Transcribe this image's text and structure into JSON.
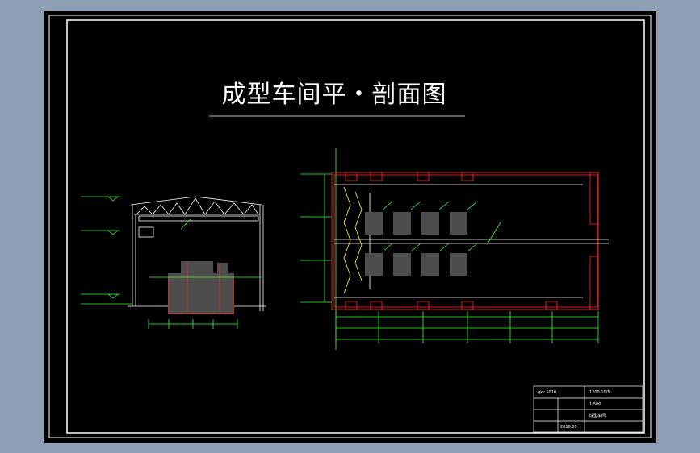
{
  "drawing": {
    "title": "成型车间平・剖面图",
    "colors": {
      "viewport_bg": "#000000",
      "frame": "#ffffff",
      "structure_red": "#ff2a2a",
      "dimension_green": "#33ff33",
      "machine_gray": "#4d4d4d",
      "hatch_yellow": "#ffff33",
      "outer_bg": "#8f9fb5"
    }
  },
  "title_block": {
    "cells": [
      "gxs 5010",
      "1200 10/5",
      "1:500",
      "成型车间",
      "2016.05"
    ]
  }
}
